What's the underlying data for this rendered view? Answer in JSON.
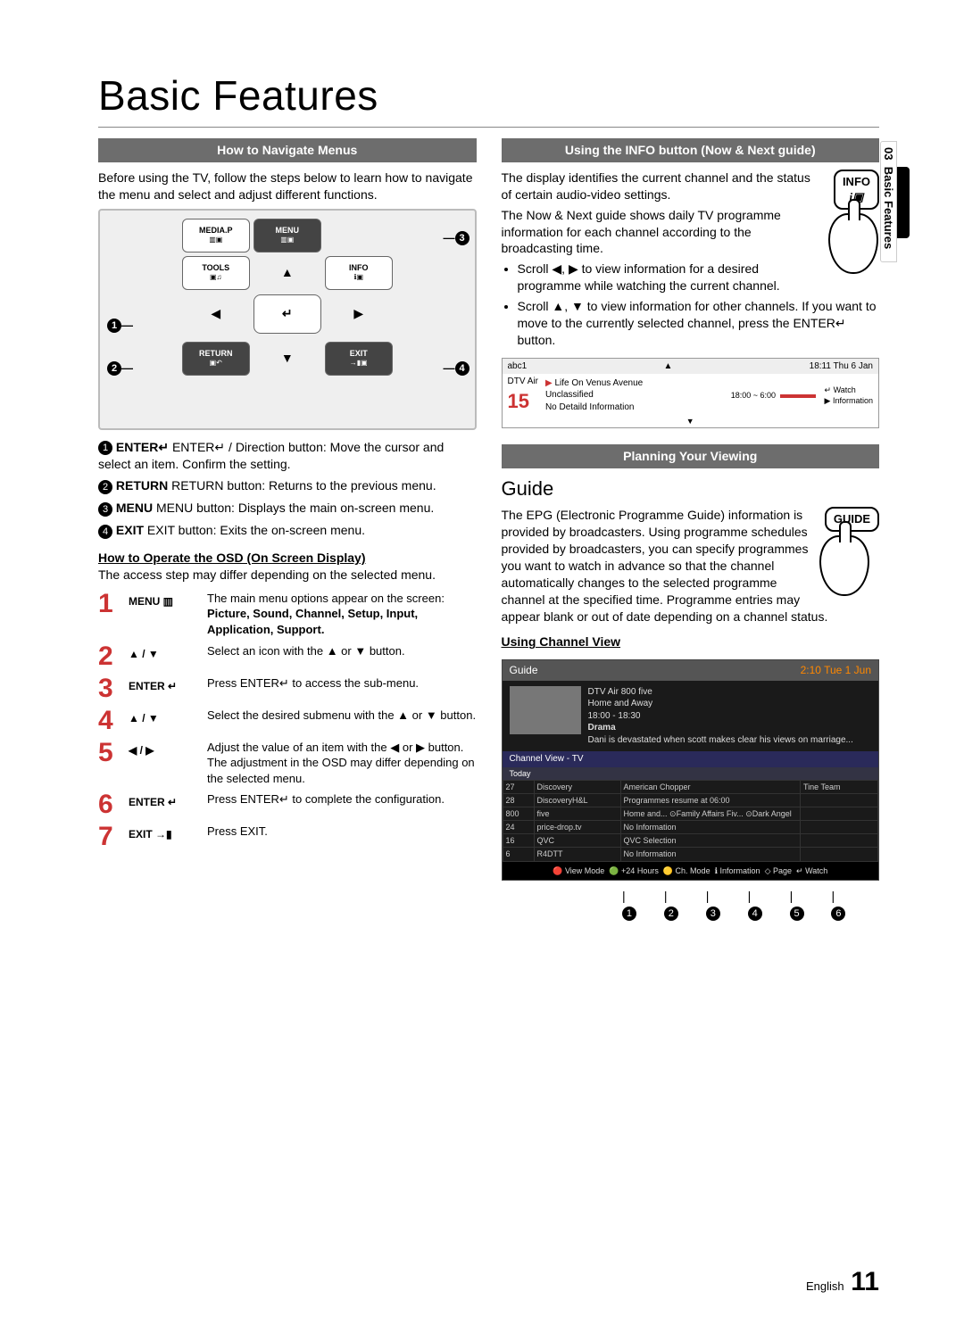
{
  "page": {
    "title": "Basic Features",
    "section_num": "03",
    "section_label": "Basic Features",
    "footer_lang": "English",
    "footer_page": "11"
  },
  "left": {
    "bar1": "How to Navigate Menus",
    "intro": "Before using the TV, follow the steps below to learn how to navigate the menu and select and adjust different functions.",
    "remote": {
      "btn_mediap": "MEDIA.P",
      "btn_menu": "MENU",
      "btn_tools": "TOOLS",
      "btn_info": "INFO",
      "btn_return": "RETURN",
      "btn_exit": "EXIT",
      "arrow_up": "▲",
      "arrow_down": "▼",
      "arrow_left": "◀",
      "arrow_right": "▶",
      "center": "↵"
    },
    "callouts": {
      "c1": "1",
      "c2": "2",
      "c3": "3",
      "c4": "4"
    },
    "numlist": {
      "i1": "ENTER↵ / Direction button: Move the cursor and select an item. Confirm the setting.",
      "i2": "RETURN button: Returns to the previous menu.",
      "i3": "MENU button: Displays the main on-screen menu.",
      "i4": "EXIT button: Exits the on-screen menu."
    },
    "osd_heading": "How to Operate the OSD (On Screen Display)",
    "osd_note": "The access step may differ depending on the selected menu.",
    "steps": [
      {
        "n": "1",
        "label": "MENU ▥",
        "desc": "The main menu options appear on the screen:",
        "bold": "Picture, Sound, Channel, Setup, Input, Application, Support."
      },
      {
        "n": "2",
        "label": "▲ / ▼",
        "desc": "Select an icon with the ▲ or ▼ button."
      },
      {
        "n": "3",
        "label": "ENTER ↵",
        "desc": "Press ENTER↵ to access the sub-menu."
      },
      {
        "n": "4",
        "label": "▲ / ▼",
        "desc": "Select the desired submenu with the ▲ or ▼ button."
      },
      {
        "n": "5",
        "label": "◀ / ▶",
        "desc": "Adjust the value of an item with the ◀ or ▶ button. The adjustment in the OSD may differ depending on the selected menu."
      },
      {
        "n": "6",
        "label": "ENTER ↵",
        "desc": "Press ENTER↵ to complete the configuration."
      },
      {
        "n": "7",
        "label": "EXIT →▮",
        "desc": "Press EXIT."
      }
    ]
  },
  "right": {
    "bar1": "Using the INFO button (Now & Next guide)",
    "info_btn_label": "INFO",
    "p1": "The display identifies the current channel and the status of certain audio-video settings.",
    "p2": "The Now & Next guide shows daily TV programme information for each channel according to the broadcasting time.",
    "b1": "Scroll ◀, ▶ to view information for a desired programme while watching the current channel.",
    "b2": "Scroll ▲, ▼ to view information for other channels. If you want to move to the currently selected channel, press the ENTER↵ button.",
    "mini": {
      "ch_name": "abc1",
      "time": "18:11 Thu 6 Jan",
      "src": "DTV Air",
      "num": "15",
      "prog": "Life On Venus Avenue",
      "cls": "Unclassified",
      "nodtl": "No Detaild Information",
      "range": "18:00 ~ 6:00",
      "watch": "Watch",
      "info": "Information"
    },
    "bar2": "Planning Your Viewing",
    "guide_heading": "Guide",
    "guide_btn_label": "GUIDE",
    "guide_p": "The EPG (Electronic Programme Guide) information is provided by broadcasters. Using programme schedules provided by broadcasters, you can specify programmes you want to watch in advance so that the channel automatically changes to the selected programme channel at the specified time. Programme entries may appear blank or out of date depending on a channel status.",
    "using_cv": "Using  Channel View",
    "epg": {
      "title": "Guide",
      "clock": "2:10 Tue 1 Jun",
      "src": "DTV Air 800 five",
      "prog": "Home and Away",
      "range": "18:00 - 18:30",
      "genre": "Drama",
      "synopsis": "Dani is devastated when scott makes clear his views on marriage...",
      "tab": "Channel View - TV",
      "today": "Today",
      "rows": [
        {
          "n": "27",
          "c": "Discovery",
          "p1": "American Chopper",
          "p2": "Tine Team"
        },
        {
          "n": "28",
          "c": "DiscoveryH&L",
          "p1": "Programmes resume at 06:00",
          "p2": ""
        },
        {
          "n": "800",
          "c": "five",
          "p1": "Home and...    ⊙Family Affairs    Fiv...    ⊙Dark Angel",
          "p2": ""
        },
        {
          "n": "24",
          "c": "price-drop.tv",
          "p1": "No Information",
          "p2": ""
        },
        {
          "n": "16",
          "c": "QVC",
          "p1": "QVC Selection",
          "p2": ""
        },
        {
          "n": "6",
          "c": "R4DTT",
          "p1": "No Information",
          "p2": ""
        }
      ],
      "footer_items": [
        "View Mode",
        "+24 Hours",
        "Ch. Mode",
        "Information",
        "Page",
        "Watch"
      ],
      "callouts": [
        "1",
        "2",
        "3",
        "4",
        "5",
        "6"
      ]
    }
  }
}
